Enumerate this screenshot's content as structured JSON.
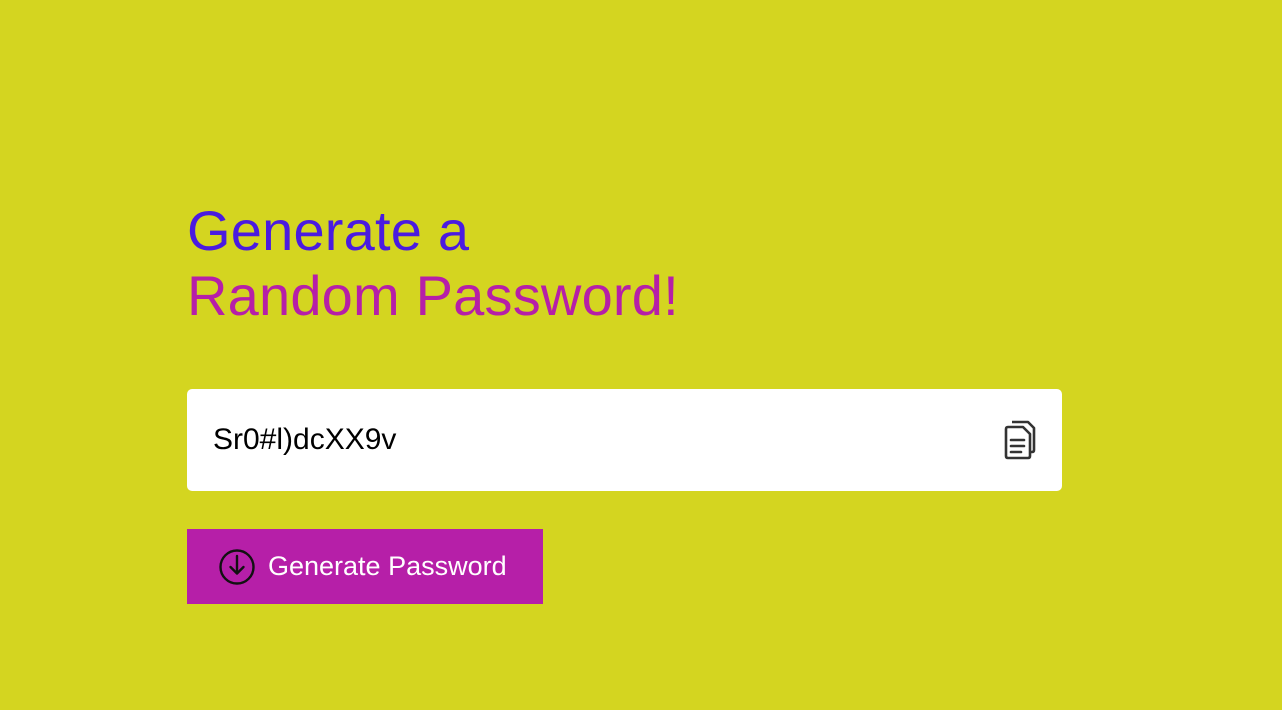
{
  "heading": {
    "line1": "Generate a",
    "line2": "Random Password!"
  },
  "password": {
    "value": "Sr0#l)dcXX9v"
  },
  "icons": {
    "copy": "copy-document-icon",
    "generate": "download-circle-icon"
  },
  "generate_button": {
    "label": "Generate Password"
  },
  "colors": {
    "background": "#d4d520",
    "heading_line1": "#4a1be0",
    "heading_line2": "#b61fa8",
    "button": "#b61fa8",
    "button_text": "#ffffff"
  }
}
